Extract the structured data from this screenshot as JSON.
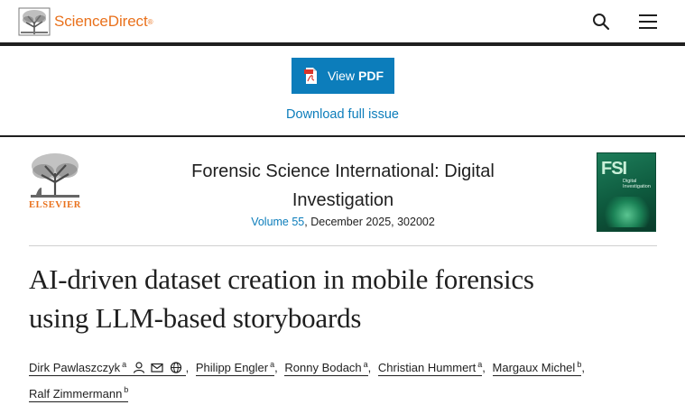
{
  "header": {
    "brand_name": "ScienceDirect",
    "brand_reg": "®",
    "search_icon": "search-icon",
    "menu_icon": "hamburger-menu-icon"
  },
  "pdf": {
    "button_label_1": "View",
    "button_label_2": "PDF",
    "download_link": "Download full issue"
  },
  "journal": {
    "publisher": "ELSEVIER",
    "title_line1": "Forensic Science International: Digital",
    "title_line2": "Investigation",
    "volume": "Volume 55",
    "issue_info": ", December 2025, 302002",
    "cover_abbrev": "FSI",
    "cover_subtitle": "Digital Investigation"
  },
  "article": {
    "title_line1": "AI-driven dataset creation in mobile forensics",
    "title_line2": "using LLM-based storyboards"
  },
  "authors": [
    {
      "name": "Dirk Pawlaszczyk",
      "aff": "a"
    },
    {
      "name": "Philipp Engler",
      "aff": "a"
    },
    {
      "name": "Ronny Bodach",
      "aff": "a"
    },
    {
      "name": "Christian Hummert",
      "aff": "a"
    },
    {
      "name": "Margaux Michel",
      "aff": "b"
    },
    {
      "name": "Ralf Zimmermann",
      "aff": "b"
    }
  ],
  "colors": {
    "brand_orange": "#e9711c",
    "link_blue": "#0c7dbb",
    "cover_green": "#0e5a3e"
  }
}
